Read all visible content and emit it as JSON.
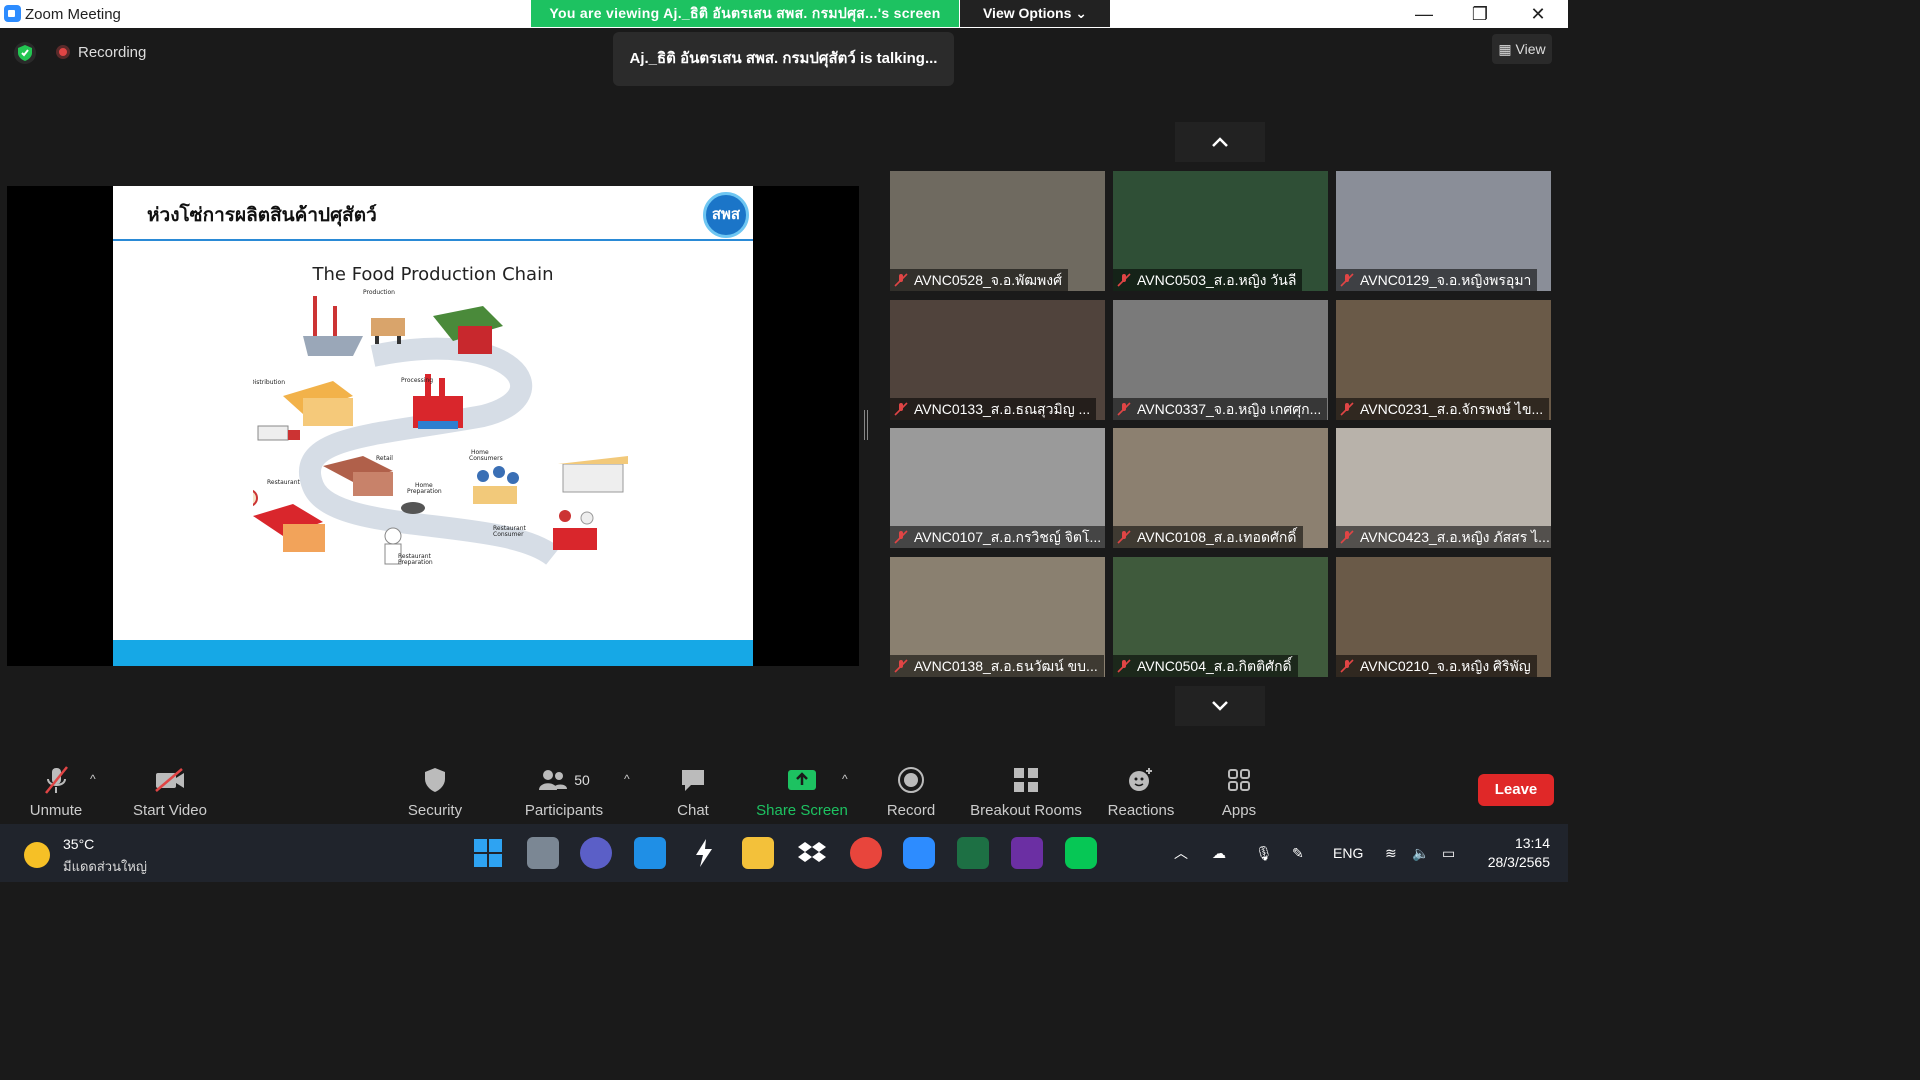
{
  "window": {
    "title": "Zoom Meeting",
    "viewing_banner": "You are viewing Aj._ธิติ อันตรเสน สพส. กรมปศุส...'s screen",
    "view_options": "View Options",
    "minimize": "—",
    "maximize": "❐",
    "close": "✕"
  },
  "meeting": {
    "recording_label": "Recording",
    "talking_indicator": "Aj._ธิติ อันตรเสน สพส. กรมปศุสัตว์ is talking...",
    "view_label": "View"
  },
  "slide": {
    "thai_title": "ห่วงโซ่การผลิตสินค้าปศุสัตว์",
    "logo_text": "สพส",
    "chain_title": "The Food Production Chain",
    "stage_labels": [
      "Production",
      "Distribution",
      "Processing",
      "Retail",
      "Home Consumers",
      "Restaurant",
      "Home Preparation",
      "Restaurant Consumer",
      "Restaurant Preparation"
    ]
  },
  "participants": [
    {
      "name": "AVNC0528_จ.อ.พัฒพงศ์"
    },
    {
      "name": "AVNC0503_ส.อ.หญิง วันลี"
    },
    {
      "name": "AVNC0129_จ.อ.หญิงพรอุมา"
    },
    {
      "name": "AVNC0133_ส.อ.ธณสุวมิญ ..."
    },
    {
      "name": "AVNC0337_จ.อ.หญิง เกศศุก..."
    },
    {
      "name": "AVNC0231_ส.อ.จักรพงษ์ ไข..."
    },
    {
      "name": "AVNC0107_ส.อ.กรวิชญ์ จิตโ..."
    },
    {
      "name": "AVNC0108_ส.อ.เทอดศักดิ์"
    },
    {
      "name": "AVNC0423_ส.อ.หญิง ภัสสร ไ..."
    },
    {
      "name": "AVNC0138_ส.อ.ธนวัฒน์ ขบ..."
    },
    {
      "name": "AVNC0504_ส.อ.กิตติศักดิ์"
    },
    {
      "name": "AVNC0210_จ.อ.หญิง ศิริพัญ"
    }
  ],
  "toolbar": {
    "unmute": "Unmute",
    "start_video": "Start Video",
    "security": "Security",
    "participants": "Participants",
    "participants_count": "50",
    "chat": "Chat",
    "share_screen": "Share Screen",
    "record": "Record",
    "breakout_rooms": "Breakout Rooms",
    "reactions": "Reactions",
    "apps": "Apps",
    "leave": "Leave"
  },
  "taskbar": {
    "temperature": "35°C",
    "weather_desc": "มีแดดส่วนใหญ่",
    "language": "ENG",
    "time": "13:14",
    "date": "28/3/2565"
  },
  "colors": {
    "banner_green": "#1dc261",
    "leave_red": "#e02828",
    "share_green": "#1dc261",
    "muted_red": "#e04545"
  }
}
